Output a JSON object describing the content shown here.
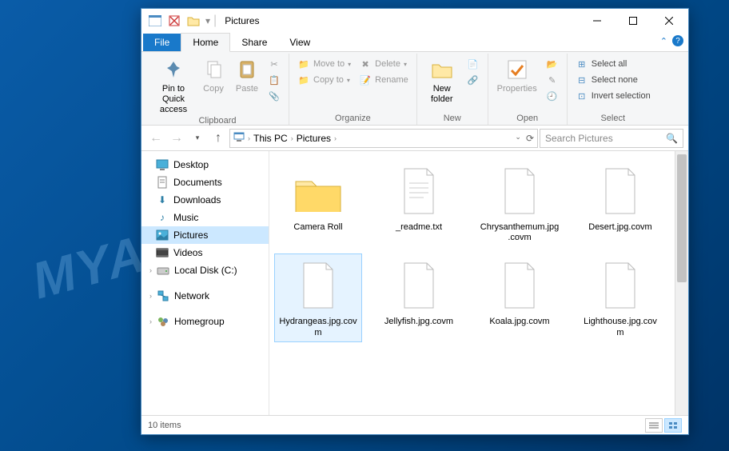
{
  "watermark": "MYANTISPYWARE.COM",
  "window": {
    "title": "Pictures"
  },
  "tabs": {
    "file": "File",
    "home": "Home",
    "share": "Share",
    "view": "View"
  },
  "ribbon": {
    "clipboard": {
      "label": "Clipboard",
      "pin": "Pin to Quick\naccess",
      "copy": "Copy",
      "paste": "Paste",
      "cut": "Cut",
      "copy_path": "Copy path",
      "paste_shortcut": "Paste shortcut"
    },
    "organize": {
      "label": "Organize",
      "move_to": "Move to",
      "copy_to": "Copy to",
      "delete": "Delete",
      "rename": "Rename"
    },
    "new": {
      "label": "New",
      "new_folder": "New\nfolder",
      "new_item": "New item",
      "easy_access": "Easy access"
    },
    "open": {
      "label": "Open",
      "properties": "Properties",
      "open": "Open",
      "edit": "Edit",
      "history": "History"
    },
    "select": {
      "label": "Select",
      "select_all": "Select all",
      "select_none": "Select none",
      "invert": "Invert selection"
    }
  },
  "breadcrumb": {
    "root": "This PC",
    "folder": "Pictures"
  },
  "search": {
    "placeholder": "Search Pictures"
  },
  "nav": {
    "desktop": "Desktop",
    "documents": "Documents",
    "downloads": "Downloads",
    "music": "Music",
    "pictures": "Pictures",
    "videos": "Videos",
    "local_disk": "Local Disk (C:)",
    "network": "Network",
    "homegroup": "Homegroup"
  },
  "files": {
    "f0": "Camera Roll",
    "f1": "_readme.txt",
    "f2": "Chrysanthemum.jpg.covm",
    "f3": "Desert.jpg.covm",
    "f4": "Hydrangeas.jpg.covm",
    "f5": "Jellyfish.jpg.covm",
    "f6": "Koala.jpg.covm",
    "f7": "Lighthouse.jpg.covm"
  },
  "status": {
    "count": "10 items"
  }
}
